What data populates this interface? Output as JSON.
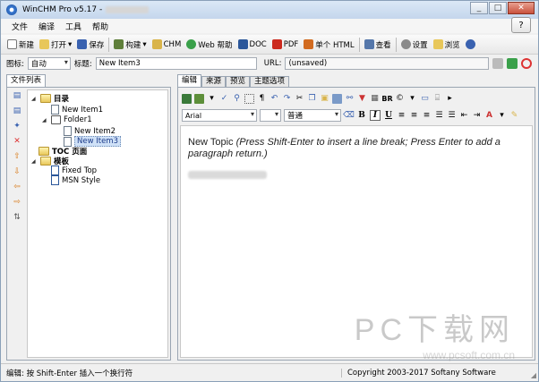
{
  "window": {
    "title": "WinCHM Pro v5.17 - ",
    "minimize": "_",
    "maximize": "□",
    "close": "✕"
  },
  "menu": [
    "文件",
    "编译",
    "工具",
    "帮助"
  ],
  "help_icon": "?",
  "toolbar": [
    {
      "name": "new",
      "label": "新建",
      "icon": "new-page-icon",
      "color": "#ffffff"
    },
    {
      "name": "open",
      "label": "打开",
      "icon": "folder-icon",
      "color": "#e8c75a"
    },
    {
      "name": "save",
      "label": "保存",
      "icon": "floppy-icon",
      "color": "#3a62b0"
    },
    {
      "name": "build",
      "label": "构建",
      "icon": "build-icon",
      "color": "#5f7f3a"
    },
    {
      "name": "chm",
      "label": "CHM",
      "icon": "chm-icon",
      "color": "#d9b44a"
    },
    {
      "name": "webhelp",
      "label": "Web 帮助",
      "icon": "globe-icon",
      "color": "#3aa04a"
    },
    {
      "name": "doc",
      "label": "DOC",
      "icon": "word-icon",
      "color": "#2b579a"
    },
    {
      "name": "pdf",
      "label": "PDF",
      "icon": "pdf-icon",
      "color": "#cc2a1e"
    },
    {
      "name": "singlehtml",
      "label": "单个 HTML",
      "icon": "html-icon",
      "color": "#d26b20"
    },
    {
      "name": "view",
      "label": "查看",
      "icon": "view-icon",
      "color": "#5577aa"
    },
    {
      "name": "settings",
      "label": "设置",
      "icon": "settings-icon",
      "color": "#8a8a8a"
    },
    {
      "name": "browse",
      "label": "浏览",
      "icon": "browse-icon",
      "color": "#e8c75a"
    }
  ],
  "props": {
    "icon_label": "图标:",
    "icon_value": "自动",
    "title_label": "标题:",
    "title_value": "New Item3",
    "url_label": "URL:",
    "url_value": "(unsaved)"
  },
  "left_tabs": [
    "文件列表"
  ],
  "tree": {
    "toc_root": "目录",
    "item1": "New Item1",
    "folder1": "Folder1",
    "item2": "New Item2",
    "item3": "New Item3",
    "toc_page": "TOC 页面",
    "templates": "模板",
    "fixed_top": "Fixed Top",
    "msn_style": "MSN Style"
  },
  "right_tabs": [
    "编辑",
    "来源",
    "预览",
    "主题选项"
  ],
  "format": {
    "font": "Arial",
    "style": "普通",
    "br_label": "BR",
    "bold": "B",
    "italic": "I",
    "underline": "U"
  },
  "editor": {
    "topic": "New Topic ",
    "hint": "(Press Shift-Enter to insert a line break; Press Enter to add a paragraph return.)"
  },
  "status": {
    "left": "编辑: 按 Shift-Enter 插入一个换行符",
    "right": "Copyright 2003-2017 Softany Software"
  },
  "watermark": {
    "big": "PC下载网",
    "small": "www.pcsoft.com.cn"
  }
}
